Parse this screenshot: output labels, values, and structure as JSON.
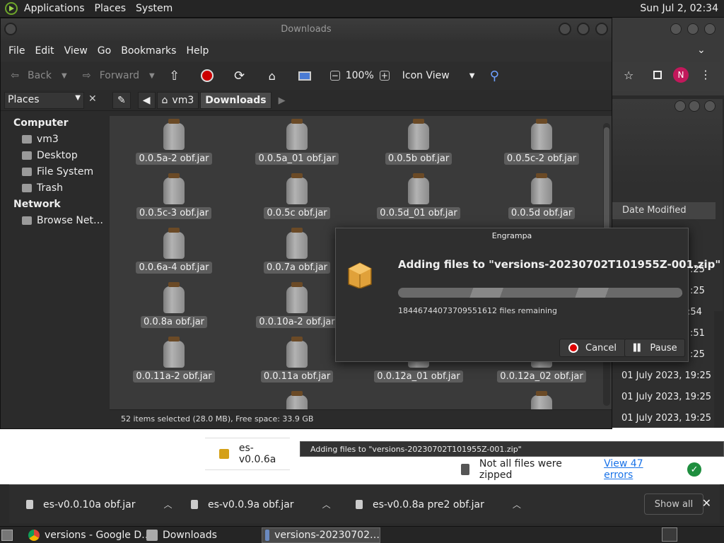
{
  "top_panel": {
    "menus": [
      "Applications",
      "Places",
      "System"
    ],
    "clock": "Sun Jul 2, 02:34"
  },
  "chrome_bg": {
    "avatar_letter": "N",
    "column_header": "Date Modified",
    "dates": [
      ":25",
      ":25",
      ":54",
      ":51",
      ":25",
      "01 July 2023, 19:25",
      "01 July 2023, 19:25",
      "01 July 2023, 19:25"
    ],
    "status_tooltip": "Adding files to \"versions-20230702T101955Z-001.zip\"",
    "not_zipped_text": "Not all files were zipped",
    "errors_link": "View 47 errors",
    "downloads": [
      {
        "name": "es-v0.0.10a obf.jar"
      },
      {
        "name": "es-v0.0.9a obf.jar"
      },
      {
        "name": "es-v0.0.8a pre2 obf.jar"
      }
    ],
    "show_all": "Show all",
    "bg_file": "es-v0.0.6a"
  },
  "caja": {
    "title": "Downloads",
    "menu": [
      "File",
      "Edit",
      "View",
      "Go",
      "Bookmarks",
      "Help"
    ],
    "toolbar": {
      "back": "Back",
      "forward": "Forward",
      "zoom": "100%",
      "view_mode": "Icon View"
    },
    "sidebar_header": "Places",
    "breadcrumbs": [
      "vm3",
      "Downloads"
    ],
    "sidebar": {
      "computer": "Computer",
      "computer_items": [
        "vm3",
        "Desktop",
        "File System",
        "Trash"
      ],
      "network": "Network",
      "network_items": [
        "Browse Net…"
      ]
    },
    "files": [
      "0.0.5a-2 obf.jar",
      "0.0.5a_01 obf.jar",
      "0.0.5b obf.jar",
      "0.0.5c-2 obf.jar",
      "0.0.5c-3 obf.jar",
      "0.0.5c obf.jar",
      "0.0.5d_01 obf.jar",
      "0.0.5d obf.jar",
      "0.0.6a-4 obf.jar",
      "0.0.7a obf.jar",
      "",
      "",
      "0.0.8a obf.jar",
      "0.0.10a-2 obf.jar",
      "",
      "",
      "0.0.11a-2 obf.jar",
      "0.0.11a obf.jar",
      "0.0.12a_01 obf.jar",
      "0.0.12a_02 obf.jar"
    ],
    "status": "52 items selected (28.0 MB), Free space: 33.9 GB"
  },
  "dialog": {
    "title": "Engrampa",
    "heading": "Adding files to \"versions-20230702T101955Z-001.zip\"",
    "remaining": "18446744073709551612 files remaining",
    "cancel": "Cancel",
    "pause": "Pause",
    "progress": 1.0
  },
  "taskbar": {
    "tasks": [
      "versions - Google D…",
      "Downloads",
      "versions-20230702…"
    ]
  },
  "colors": {
    "accent_red": "#dd0000",
    "jar_lid": "#6b4a26",
    "link_blue": "#1a73e8"
  }
}
